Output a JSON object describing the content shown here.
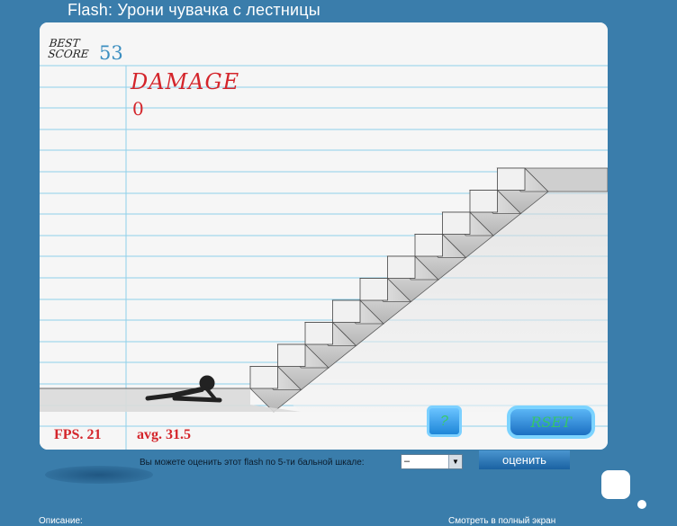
{
  "page": {
    "title": "Flash: Урони чувачка с лестницы"
  },
  "game": {
    "best_label_line1": "BEST",
    "best_label_line2": "SCORE",
    "best_value": "53",
    "damage_label": "DAMAGE",
    "damage_value": "0",
    "fps": "FPS. 21",
    "avg": "avg. 31.5",
    "help_button": "?",
    "reset_button": "RSET"
  },
  "rating": {
    "label": "Вы можете оценить этот flash по 5-ти бальной шкале:",
    "select_value": "–",
    "button": "оценить"
  },
  "footer": {
    "left": "Описание:",
    "right": "Смотреть в полный экран"
  },
  "colors": {
    "background": "#3a7dab",
    "accent_red": "#d4252b",
    "score_blue": "#3b8ec0",
    "line_blue": "#7fcbe6"
  },
  "icons": {
    "stick_figure": "stick-figure-lying",
    "stairs": "staircase"
  }
}
